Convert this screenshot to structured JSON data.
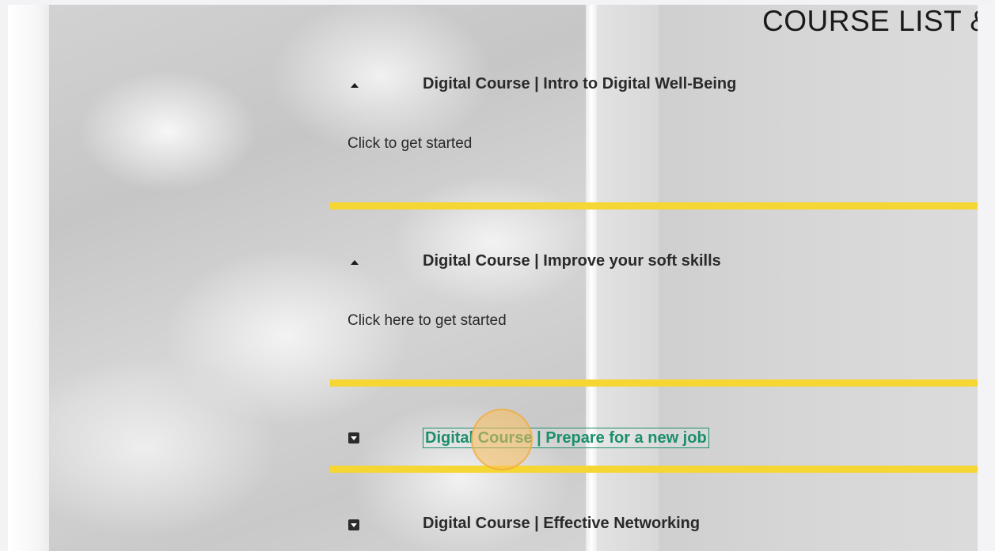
{
  "page": {
    "title": "COURSE LIST &"
  },
  "courses": [
    {
      "title": "Digital Course | Intro to Digital Well-Being",
      "description": "Click to get started",
      "state": "expanded"
    },
    {
      "title": "Digital Course | Improve your soft skills",
      "description": "Click here to get started",
      "state": "expanded"
    },
    {
      "title": "Digital Course | Prepare for a new job",
      "description": "",
      "state": "collapsed"
    },
    {
      "title": "Digital Course | Effective Networking",
      "description": "",
      "state": "collapsed"
    }
  ],
  "colors": {
    "divider": "#f5d632",
    "active_link": "#1b8f6d",
    "click_marker": "#f6b552"
  },
  "icons": {
    "expanded": "caret-up-icon",
    "collapsed": "caret-down-box-icon"
  }
}
